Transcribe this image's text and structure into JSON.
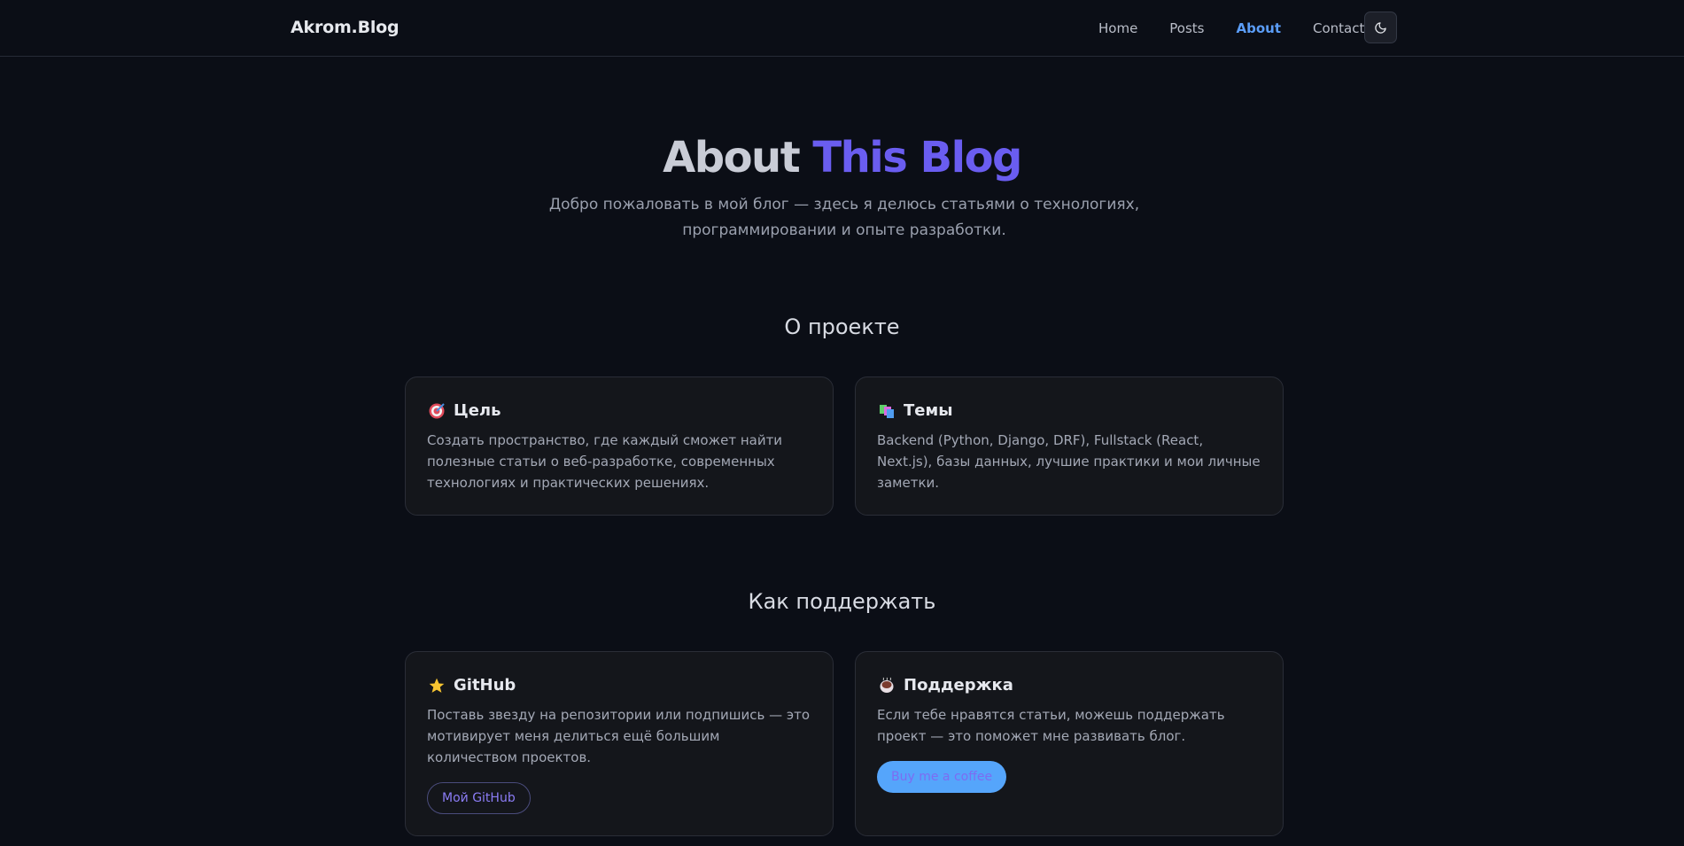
{
  "header": {
    "brand": "Akrom.Blog",
    "nav": [
      "Home",
      "Posts",
      "About",
      "Contact"
    ],
    "active": "About",
    "theme_toggle_icon": "moon-icon"
  },
  "hero": {
    "title_part1": "About",
    "title_part2": "This Blog",
    "subtitle": "Добро пожаловать в мой блог — здесь я делюсь статьями о технологиях, программировании и опыте разработки."
  },
  "about_section": {
    "title": "О проекте",
    "cards": [
      {
        "icon": "target-icon",
        "title": "Цель",
        "text": "Создать пространство, где каждый сможет найти полезные статьи о веб-разработке, современных технологиях и практических решениях."
      },
      {
        "icon": "books-icon",
        "title": "Темы",
        "text": "Backend (Python, Django, DRF), Fullstack (React, Next.js), базы данных, лучшие практики и мои личные заметки."
      }
    ]
  },
  "support_section": {
    "title": "Как поддержать",
    "cards": [
      {
        "icon": "star-icon",
        "title": "GitHub",
        "text": "Поставь звезду на репозитории или подпишись — это мотивирует меня делиться ещё большим количеством проектов.",
        "button": "Мой GitHub"
      },
      {
        "icon": "coffee-icon",
        "title": "Поддержка",
        "text": "Если тебе нравятся статьи, можешь поддержать проект — это поможет мне развивать блог.",
        "button": "Buy me a coffee"
      }
    ]
  },
  "colors": {
    "background": "#0b0e16",
    "accent_purple": "#6a5df0",
    "nav_active": "#5b9df7",
    "coffee_button": "#55a5fb"
  }
}
